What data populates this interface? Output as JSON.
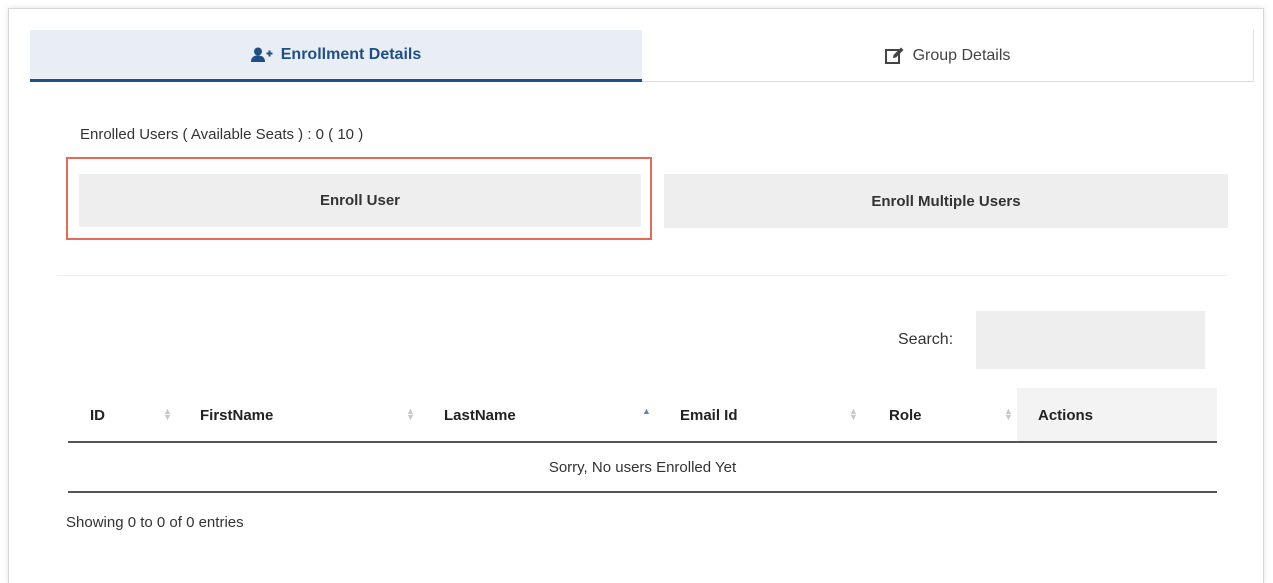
{
  "tabs": [
    {
      "label": "Enrollment Details",
      "icon": "add-user-icon",
      "active": true
    },
    {
      "label": "Group Details",
      "icon": "edit-icon",
      "active": false
    }
  ],
  "seats_text": "Enrolled Users ( Available Seats ) : 0 ( 10 )",
  "buttons": {
    "enroll_user": "Enroll User",
    "enroll_multiple": "Enroll Multiple Users"
  },
  "search": {
    "label": "Search:",
    "value": ""
  },
  "table": {
    "columns": [
      "ID",
      "FirstName",
      "LastName",
      "Email Id",
      "Role",
      "Actions"
    ],
    "sorted_column": "LastName",
    "sort_direction": "ascending",
    "empty_message": "Sorry, No users Enrolled Yet"
  },
  "info_text": "Showing 0 to 0 of 0 entries",
  "colors": {
    "accent": "#1f4f87",
    "highlight_border": "#e36b57",
    "button_bg": "#eeeeee"
  }
}
